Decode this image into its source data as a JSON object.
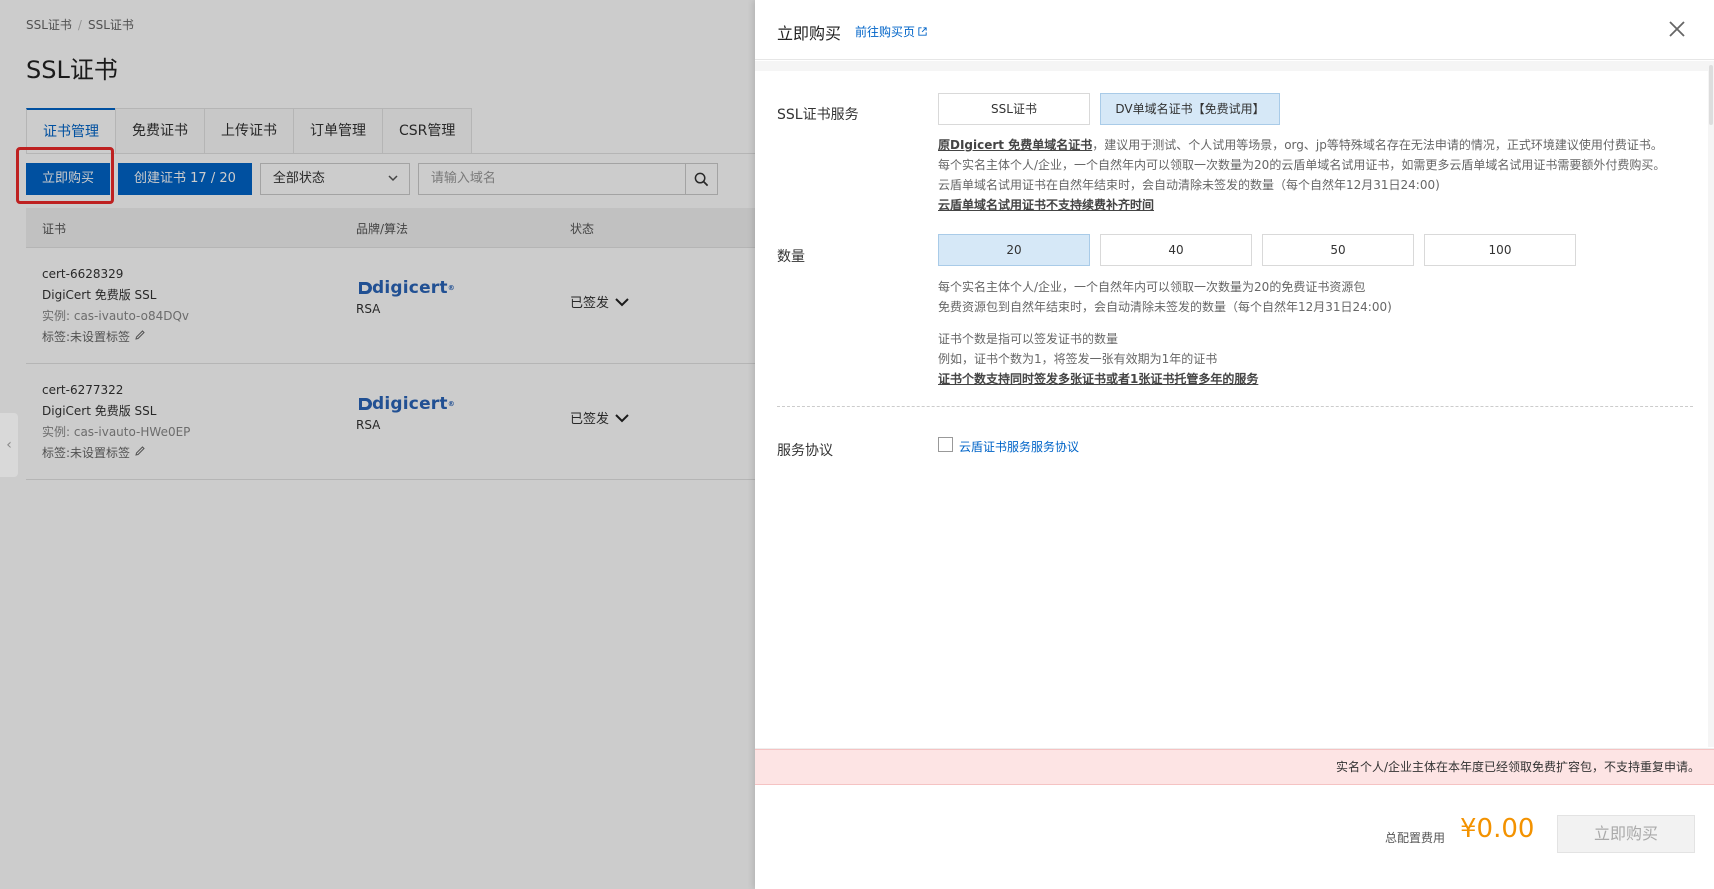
{
  "breadcrumb": [
    "SSL证书",
    "SSL证书"
  ],
  "page_title": "SSL证书",
  "tabs": [
    "证书管理",
    "免费证书",
    "上传证书",
    "订单管理",
    "CSR管理"
  ],
  "toolbar": {
    "buy_label": "立即购买",
    "create_label": "创建证书 17 / 20",
    "status_select": "全部状态",
    "search_placeholder": "请输入域名"
  },
  "table": {
    "headers": [
      "证书",
      "品牌/算法",
      "状态"
    ],
    "rows": [
      {
        "id": "cert-6628329",
        "name": "DigiCert 免费版 SSL",
        "instance": "实例: cas-ivauto-o84DQv",
        "tag": "标签:未设置标签",
        "brand": "digicert",
        "algo": "RSA",
        "status": "已签发"
      },
      {
        "id": "cert-6277322",
        "name": "DigiCert 免费版 SSL",
        "instance": "实例: cas-ivauto-HWe0EP",
        "tag": "标签:未设置标签",
        "brand": "digicert",
        "algo": "RSA",
        "status": "已签发"
      }
    ]
  },
  "drawer": {
    "title": "立即购买",
    "link": "前往购买页",
    "service": {
      "label": "SSL证书服务",
      "options": [
        "SSL证书",
        "DV单域名证书【免费试用】"
      ],
      "selected": 1,
      "desc_strong1": "原DIgicert 免费单域名证书",
      "desc_line1": "，建议用于测试、个人试用等场景，org、jp等特殊域名存在无法申请的情况，正式环境建议使用付费证书。",
      "desc_line2": "每个实名主体个人/企业，一个自然年内可以领取一次数量为20的云盾单域名试用证书，如需更多云盾单域名试用证书需要额外付费购买。",
      "desc_line3": "云盾单域名试用证书在自然年结束时，会自动清除未签发的数量（每个自然年12月31日24:00)",
      "desc_strong2": "云盾单域名试用证书不支持续费补齐时间"
    },
    "quantity": {
      "label": "数量",
      "options": [
        "20",
        "40",
        "50",
        "100"
      ],
      "selected": 0,
      "desc_line1": "每个实名主体个人/企业，一个自然年内可以领取一次数量为20的免费证书资源包",
      "desc_line2": "免费资源包到自然年结束时，会自动清除未签发的数量（每个自然年12月31日24:00)",
      "desc_line3": "证书个数是指可以签发证书的数量",
      "desc_line4": "例如，证书个数为1，将签发一张有效期为1年的证书",
      "desc_strong": "证书个数支持同时签发多张证书或者1张证书托管多年的服务"
    },
    "agreement": {
      "label": "服务协议",
      "link": "云盾证书服务服务协议"
    },
    "warning": "实名个人/企业主体在本年度已经领取免费扩容包，不支持重复申请。",
    "footer": {
      "fee_label": "总配置费用",
      "price": "¥0.00",
      "buy_label": "立即购买"
    }
  },
  "colors": {
    "primary": "#0064c8",
    "price": "#f39200",
    "highlight": "#ee2a2a",
    "warning_bg": "#fde4e4"
  }
}
